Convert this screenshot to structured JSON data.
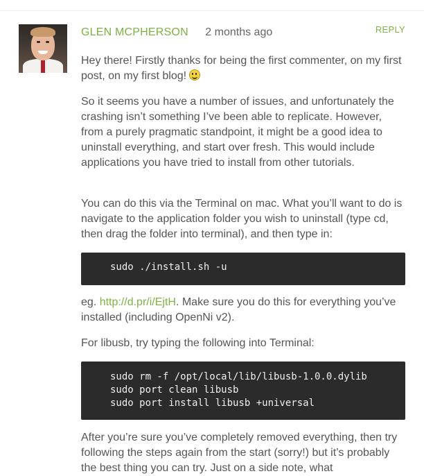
{
  "comment": {
    "author": "GLEN MCPHERSON",
    "date": "2 months ago",
    "reply_label": "REPLY",
    "paragraphs": {
      "p1": "Hey there! Firstly thanks for being the first commenter, on my first post, on my first blog!",
      "p2": "So it seems you have a number of issues, and unfortunately the crashing isn’t something I’ve been able to replicate. However, from a purely pragmatic standpoint, it might be a good idea to uninstall everything, and start over fresh. This would include applications you have tried to install from other tutorials.",
      "p3": "You can do this via the Terminal on mac. What you’ll want to do is navigate to the application folder you wish to uninstall (type cd, then drag the folder into terminal), and then type in:",
      "p4_before": "eg. ",
      "p4_link": "http://d.pr/i/EjtH",
      "p4_after": ". Make sure you do this for everything you’ve installed (including OpenNi v2).",
      "p5": "For libusb, try typing the following into Terminal:",
      "p6": "After you’re sure you’ve completely removed everything, then try following the steps again from the start (sorry!) but it’s probably the best thing you can try. Just on a side note, what"
    },
    "code1": "sudo ./install.sh -u",
    "code2": "sudo rm -f /opt/local/lib/libusb-1.0.0.dylib\nsudo port clean libusb\nsudo port install libusb +universal",
    "icons": {
      "emoji": "smiley-emoji-icon"
    },
    "colors": {
      "accent": "#7cb342",
      "code_bg": "#2b2b2b",
      "text": "#555555"
    }
  }
}
